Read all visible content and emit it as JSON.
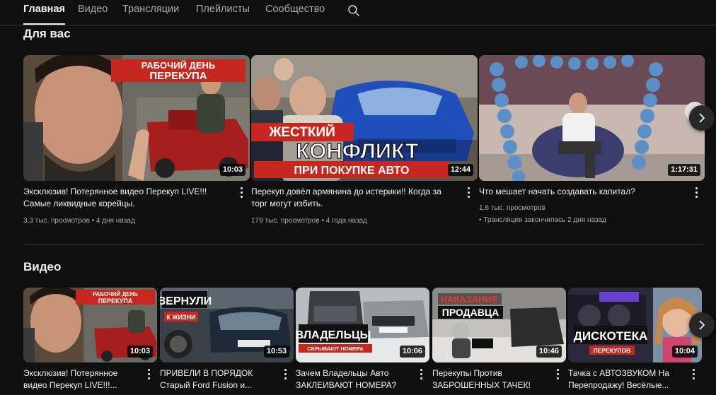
{
  "tabs": [
    {
      "label": "Главная",
      "active": true
    },
    {
      "label": "Видео",
      "active": false
    },
    {
      "label": "Трансляции",
      "active": false
    },
    {
      "label": "Плейлисты",
      "active": false
    },
    {
      "label": "Сообщество",
      "active": false
    }
  ],
  "for_you": {
    "title": "Для вас",
    "videos": [
      {
        "title": "Эксклюзив! Потерянное видео Перекуп LIVE!!! Самые ликвидные корейцы.",
        "duration": "10:03",
        "views": "3,3 тыс. просмотров",
        "age": "4 дня назад",
        "thumb_text": [
          "РАБОЧИЙ ДЕНЬ",
          "ПЕРЕКУПА"
        ]
      },
      {
        "title": "Перекуп довёл армянина до истерики!! Когда за торг могут избить.",
        "duration": "12:44",
        "views": "179 тыс. просмотров",
        "age": "4 года назад",
        "thumb_text": [
          "ЖЕСТКИЙ",
          "КОНФЛИКТ",
          "ПРИ ПОКУПКЕ АВТО"
        ]
      },
      {
        "title": "Что мешает начать создавать капитал?",
        "duration": "1:17:31",
        "views": "1,6 тыс. просмотров",
        "age": "Трансляция закончилась 2 дня назад"
      }
    ]
  },
  "videos_section": {
    "title": "Видео",
    "videos": [
      {
        "title_line1": "Эксклюзив! Потерянное",
        "title_line2": "видео Перекуп LIVE!!!...",
        "duration": "10:03",
        "thumb_text": [
          "РАБОЧИЙ ДЕНЬ",
          "ПЕРЕКУПА"
        ]
      },
      {
        "title_line1": "ПРИВЕЛИ В ПОРЯДОК",
        "title_line2": "Старый Ford Fusion и...",
        "duration": "10:53",
        "thumb_text": [
          "ВЕРНУЛИ",
          "К ЖИЗНИ"
        ]
      },
      {
        "title_line1": "Зачем Владельцы Авто",
        "title_line2": "ЗАКЛЕИВАЮТ НОМЕРА?",
        "duration": "10:06",
        "thumb_text": [
          "ВЛАДЕЛЬЦЫ",
          "СКРЫВАЮТ НОМЕРА"
        ]
      },
      {
        "title_line1": "Перекупы Против",
        "title_line2": "ЗАБРОШЕННЫХ ТАЧЕК!",
        "duration": "10:46",
        "thumb_text": [
          "НАКАЗАНИЕ",
          "ПРОДАВЦА"
        ]
      },
      {
        "title_line1": "Тачка с АВТОЗВУКОМ На",
        "title_line2": "Перепродажу! Весёлые...",
        "duration": "10:04",
        "thumb_text": [
          "ДИСКОТЕКА",
          "ПЕРЕКУПОВ"
        ]
      }
    ]
  },
  "icons": {
    "search": "search-icon",
    "next": "chevron-right-icon",
    "more": "more-vert-icon"
  }
}
